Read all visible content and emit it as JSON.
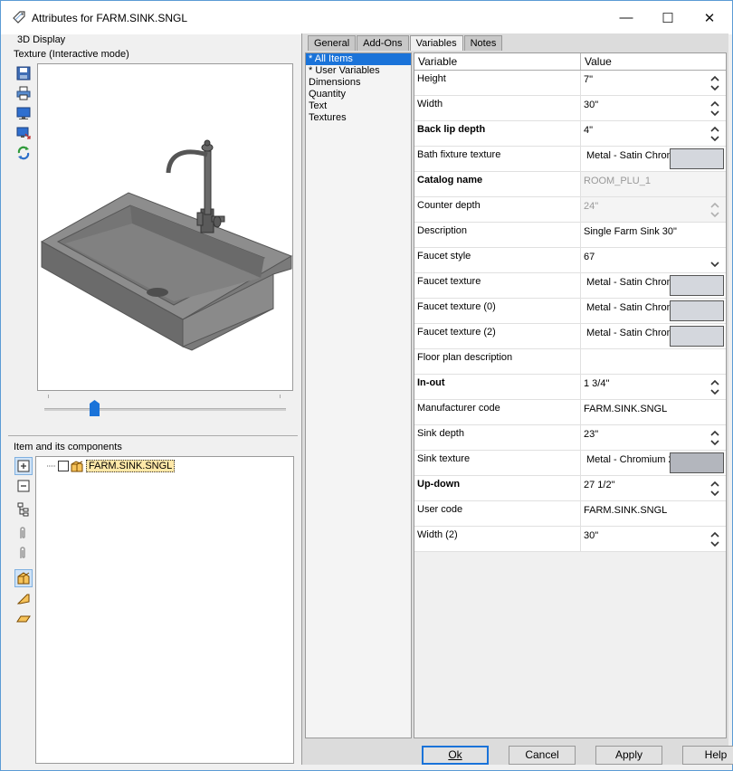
{
  "window": {
    "title": "Attributes for FARM.SINK.SNGL",
    "controls": {
      "minimize": "—",
      "maximize": "☐",
      "close": "✕"
    }
  },
  "left": {
    "display_group": "3D Display",
    "mode_label": "Texture (Interactive mode)",
    "toolbar": [
      "save-icon",
      "print-icon",
      "monitor-icon",
      "monitor-export-icon",
      "refresh-icon"
    ],
    "components_label": "Item and its components",
    "tree": {
      "item": "FARM.SINK.SNGL"
    }
  },
  "tabs": [
    "General",
    "Add-Ons",
    "Variables",
    "Notes"
  ],
  "active_tab": "Variables",
  "categories": [
    "* All Items",
    "* User Variables",
    "Dimensions",
    "Quantity",
    "Text",
    "Textures"
  ],
  "grid": {
    "headers": {
      "variable": "Variable",
      "value": "Value"
    },
    "rows": [
      {
        "name": "Height",
        "value": "7\"",
        "bold": false,
        "spin": true
      },
      {
        "name": "Width",
        "value": "30\"",
        "bold": false,
        "spin": true
      },
      {
        "name": "Back lip depth",
        "value": "4\"",
        "bold": true,
        "spin": true
      },
      {
        "name": "Bath fixture texture",
        "value": "Metal - Satin Chrom",
        "bold": false,
        "swatch": true
      },
      {
        "name": "Catalog name",
        "value": "ROOM_PLU_1",
        "bold": true,
        "disabled": true
      },
      {
        "name": "Counter depth",
        "value": "24\"",
        "bold": false,
        "spin": true,
        "disabled": true
      },
      {
        "name": "Description",
        "value": "Single Farm Sink 30\"",
        "bold": false
      },
      {
        "name": "Faucet style",
        "value": "67",
        "bold": false,
        "dropdown": true
      },
      {
        "name": "Faucet texture",
        "value": "Metal - Satin Chrom",
        "bold": false,
        "swatch": true
      },
      {
        "name": "Faucet texture (0)",
        "value": "Metal - Satin Chrom",
        "bold": false,
        "swatch": true
      },
      {
        "name": "Faucet texture (2)",
        "value": "Metal - Satin Chrom",
        "bold": false,
        "swatch": true
      },
      {
        "name": "Floor plan description",
        "value": "",
        "bold": false
      },
      {
        "name": "In-out",
        "value": "1 3/4\"",
        "bold": true,
        "spin": true
      },
      {
        "name": "Manufacturer code",
        "value": "FARM.SINK.SNGL",
        "bold": false
      },
      {
        "name": "Sink depth",
        "value": "23\"",
        "bold": false,
        "spin": true
      },
      {
        "name": "Sink texture",
        "value": "Metal - Chromium 2",
        "bold": false,
        "swatch": true,
        "dark": true
      },
      {
        "name": "Up-down",
        "value": "27 1/2\"",
        "bold": true,
        "spin": true
      },
      {
        "name": "User code",
        "value": "FARM.SINK.SNGL",
        "bold": false
      },
      {
        "name": "Width (2)",
        "value": "30\"",
        "bold": false,
        "spin": true
      }
    ]
  },
  "buttons": {
    "ok": "Ok",
    "cancel": "Cancel",
    "apply": "Apply",
    "help": "Help"
  }
}
